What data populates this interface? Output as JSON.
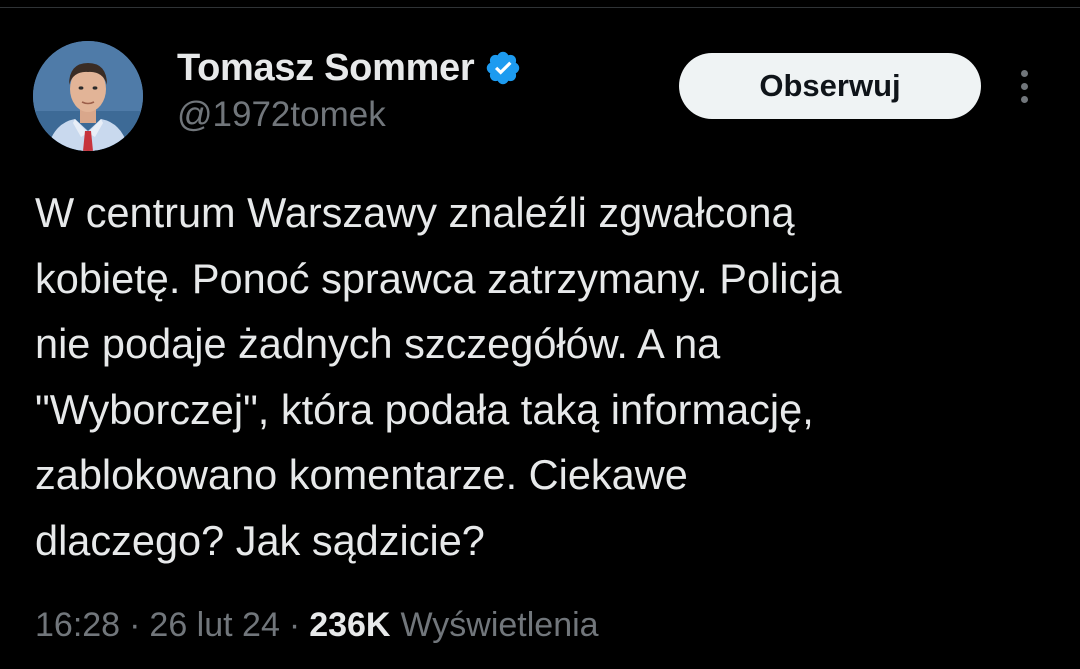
{
  "author": {
    "display_name": "Tomasz Sommer",
    "handle": "@1972tomek",
    "verified_icon": "verified-badge-icon",
    "avatar": "profile-photo"
  },
  "actions": {
    "follow_label": "Obserwuj",
    "more_icon": "more-vertical-icon"
  },
  "tweet": {
    "text": "W centrum Warszawy znaleźli zgwałconą\nkobietę. Ponoć sprawca zatrzymany. Policja\nnie podaje żadnych szczegółów. A na\n\"Wyborczej\", która podała taką informację,\nzablokowano komentarze. Ciekawe\ndlaczego? Jak sądzicie?"
  },
  "meta": {
    "time": "16:28",
    "separator": "·",
    "date": "26 lut 24",
    "views_count": "236K",
    "views_label": "Wyświetlenia"
  },
  "colors": {
    "background": "#000000",
    "primary_text": "#e7e9ea",
    "secondary_text": "#71767b",
    "verified_blue": "#1d9bf0",
    "follow_button_bg": "#eff3f4"
  }
}
